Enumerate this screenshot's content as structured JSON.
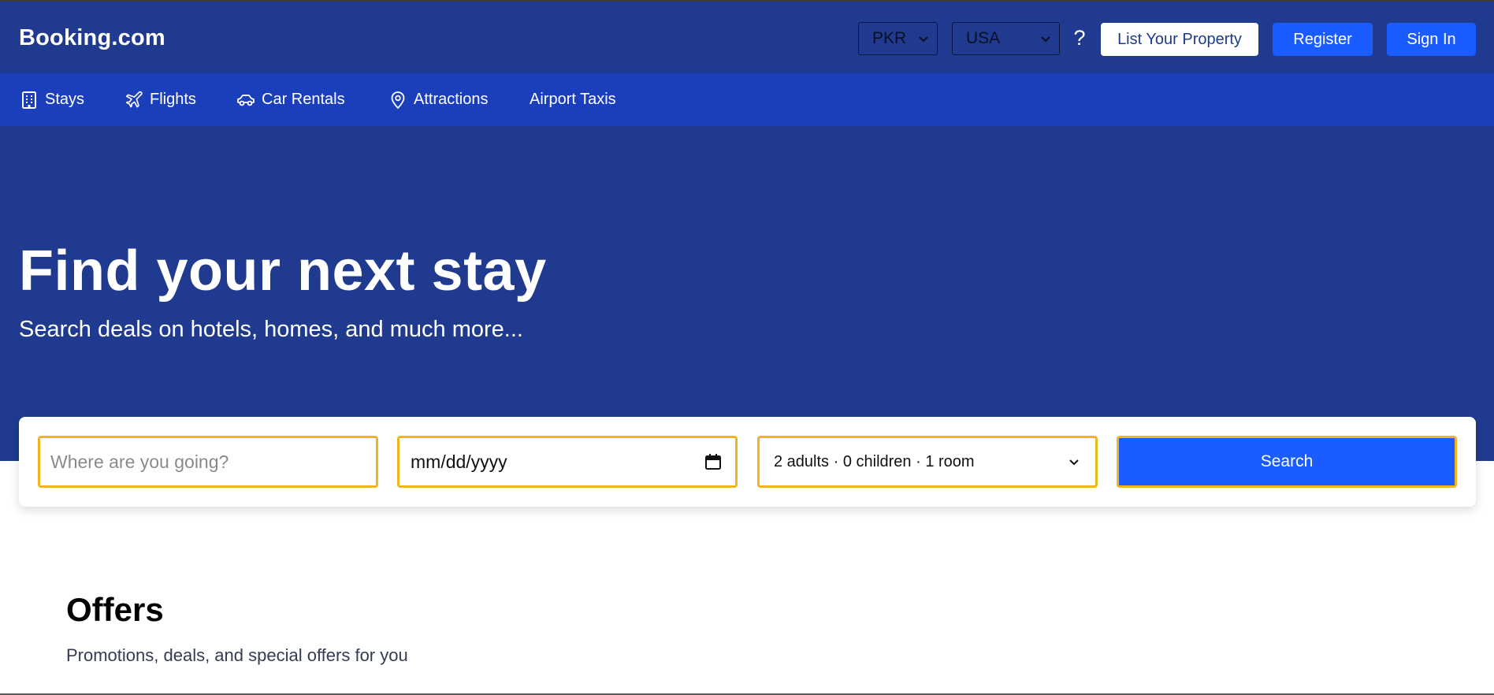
{
  "header": {
    "logo": "Booking.com",
    "currency": "PKR",
    "country": "USA",
    "help": "?",
    "list_property": "List Your Property",
    "register": "Register",
    "sign_in": "Sign In"
  },
  "nav": {
    "items": [
      {
        "label": "Stays",
        "icon": "building-icon"
      },
      {
        "label": "Flights",
        "icon": "plane-icon"
      },
      {
        "label": "Car Rentals",
        "icon": "car-icon"
      },
      {
        "label": "Attractions",
        "icon": "map-pin-icon"
      },
      {
        "label": "Airport Taxis",
        "icon": ""
      }
    ]
  },
  "hero": {
    "title": "Find your next stay",
    "subtitle": "Search deals on hotels, homes, and much more..."
  },
  "search": {
    "destination_placeholder": "Where are you going?",
    "destination_value": "",
    "date_value": "mm/dd/yyyy",
    "guests_value": "2 adults · 0 children · 1 room",
    "button": "Search"
  },
  "offers": {
    "title": "Offers",
    "subtitle": "Promotions, deals, and special offers for you"
  },
  "colors": {
    "header_bg": "#1f3a8f",
    "nav_bg": "#1b3fbb",
    "accent_blue": "#1a5cff",
    "field_border": "#f0b51c"
  }
}
